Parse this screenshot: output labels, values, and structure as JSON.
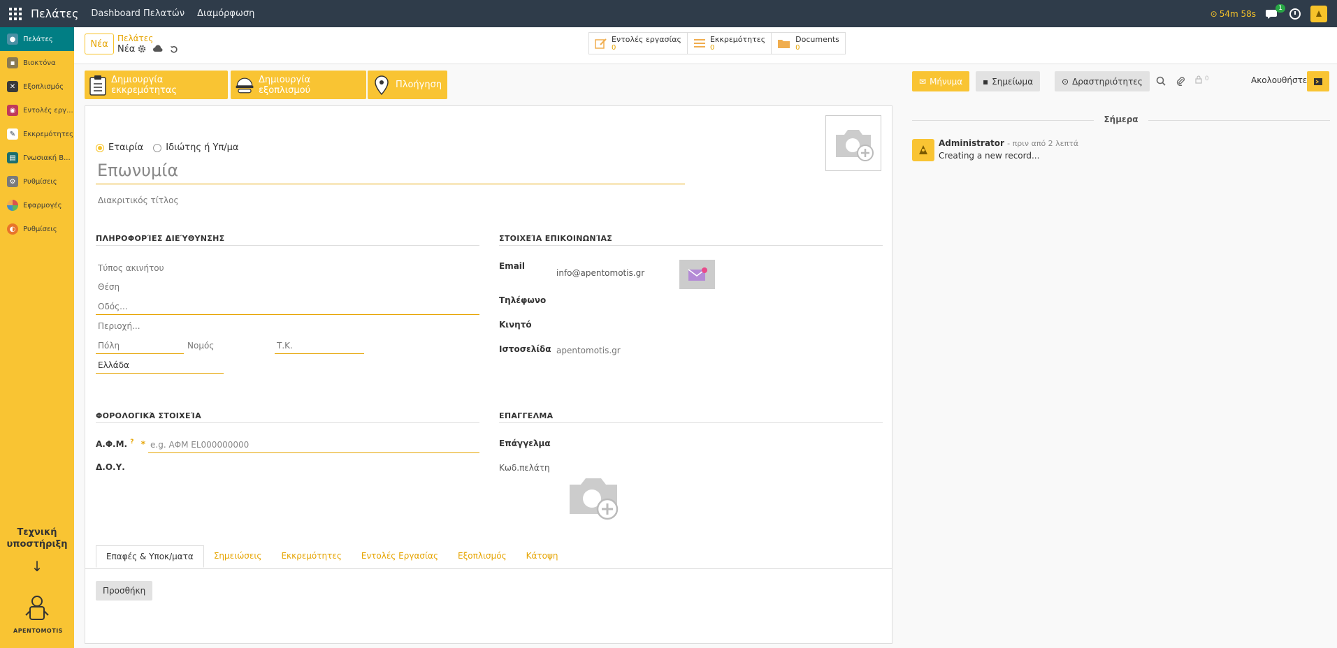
{
  "topbar": {
    "app_title": "Πελάτες",
    "menu": [
      "Dashboard Πελατών",
      "Διαμόρφωση"
    ],
    "timer": "54m 58s",
    "chat_badge": "1"
  },
  "sidebar": {
    "items": [
      {
        "label": "Πελάτες",
        "icon": "users-icon",
        "color": "#4a90a4"
      },
      {
        "label": "Βιοκτόνα",
        "icon": "biocide-icon",
        "color": "#8a7a52"
      },
      {
        "label": "Εξοπλισμός",
        "icon": "tools-icon",
        "color": "#3a3a3a"
      },
      {
        "label": "Εντολές εργ...",
        "icon": "work-orders-icon",
        "color": "#c0395a"
      },
      {
        "label": "Εκκρεμότητες",
        "icon": "pencil-icon",
        "color": "#2f3c4a"
      },
      {
        "label": "Γνωσιακή Β...",
        "icon": "knowledge-icon",
        "color": "#1b6e6e"
      },
      {
        "label": "Ρυθμίσεις",
        "icon": "gear-icon",
        "color": "#7a7a7a"
      },
      {
        "label": "Εφαρμογές",
        "icon": "apps-icon",
        "color": "#d9534f"
      },
      {
        "label": "Ρυθμίσεις",
        "icon": "settings-icon",
        "color": "#e8742a"
      }
    ],
    "support_line1": "Τεχνική",
    "support_line2": "υποστήριξη",
    "support_arrow": "↓",
    "logo_text": "ΑΡΕΝΤΟΜΟΤΙS"
  },
  "control": {
    "new_button": "Νέα",
    "breadcrumb_parent": "Πελάτες",
    "breadcrumb_current": "Νέα",
    "smart_buttons": [
      {
        "label": "Εντολές εργασίας",
        "count": "0",
        "icon": "edit-icon"
      },
      {
        "label": "Εκκρεμότητες",
        "count": "0",
        "icon": "list-icon"
      },
      {
        "label": "Documents",
        "count": "0",
        "icon": "folder-icon"
      }
    ]
  },
  "actions": {
    "create_pending": "Δημιουργία εκκρεμότητας",
    "create_equipment": "Δημιουργία εξοπλισμού",
    "navigation": "Πλοήγηση"
  },
  "form": {
    "radio_company": "Εταιρία",
    "radio_individual": "Ιδιώτης ή Υπ/μα",
    "name_placeholder": "Επωνυμία",
    "trade_name": "Διακριτικός τίτλος",
    "address_section": "ΠΛΗΡΟΦΟΡΊΕΣ ΔΙΕΎΘΥΝΣΗΣ",
    "property_type": "Τύπος ακινήτου",
    "position": "Θέση",
    "street": "Οδός...",
    "area": "Περιοχή...",
    "city": "Πόλη",
    "state": "Νομός",
    "zip": "Τ.Κ.",
    "country": "Ελλάδα",
    "contact_section": "ΣΤΟΙΧΕΊΑ ΕΠΙΚΟΙΝΩΝΊΑΣ",
    "email_label": "Email",
    "email_value": "info@apentomotis.gr",
    "phone_label": "Τηλέφωνο",
    "mobile_label": "Κινητό",
    "website_label": "Ιστοσελίδα",
    "website_value": "apentomotis.gr",
    "tax_section": "ΦΟΡΟΛΟΓΙΚΆ ΣΤΟΙΧΕΊΑ",
    "vat_label": "Α.Φ.Μ.",
    "vat_help": "?",
    "vat_required": "*",
    "vat_placeholder": "e.g. ΑΦΜ EL000000000",
    "tax_office_label": "Δ.Ο.Υ.",
    "profession_section": "ΕΠΑΓΓΕΛΜΑ",
    "profession_label": "Επάγγελμα",
    "customer_code_label": "Κωδ.πελάτη",
    "tabs": [
      "Επαφές & Υποκ/ματα",
      "Σημειώσεις",
      "Εκκρεμότητες",
      "Εντολές Εργασίας",
      "Εξοπλισμός",
      "Κάτοψη"
    ],
    "add_button": "Προσθήκη"
  },
  "chatter": {
    "message_button": "Μήνυμα",
    "note_button": "Σημείωμα",
    "activities_button": "Δραστηριότητες",
    "attachments_count": "0",
    "follow": "Ακολουθήστε",
    "today": "Σήμερα",
    "author": "Administrator",
    "time": "- πριν από 2 λεπτά",
    "body": "Creating a new record..."
  },
  "colors": {
    "accent": "#f9c433",
    "accent_text": "#e6a400",
    "topbar": "#2f3c4a",
    "sidebar_active": "#017e84"
  }
}
